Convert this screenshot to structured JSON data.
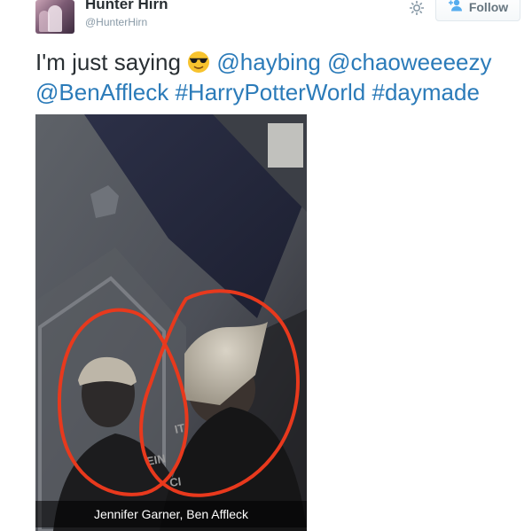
{
  "tweet": {
    "author": {
      "display_name": "Hunter Hirn",
      "handle": "@HunterHirn",
      "avatar_icon": "profile-photo"
    },
    "actions": {
      "settings_icon": "gear-icon",
      "follow_label": "Follow",
      "follow_icon": "add-user-icon"
    },
    "text": {
      "line1_plain": "I'm just saying",
      "emoji": "smiling-face-with-sunglasses",
      "mention_haybing": "@haybing",
      "mention_chaoweeeezy": "@chaoweeeezy",
      "mention_benaffleck": "@BenAffleck",
      "hashtag_harrypotterworld": "#HarryPotterWorld",
      "hashtag_daymade": "#daymade"
    },
    "photo": {
      "caption": "Jennifer Garner, Ben Affleck"
    }
  },
  "colors": {
    "link": "#2b7bb9",
    "text": "#292f33",
    "muted": "#8899a6",
    "circle_annotation": "#e8391d"
  }
}
